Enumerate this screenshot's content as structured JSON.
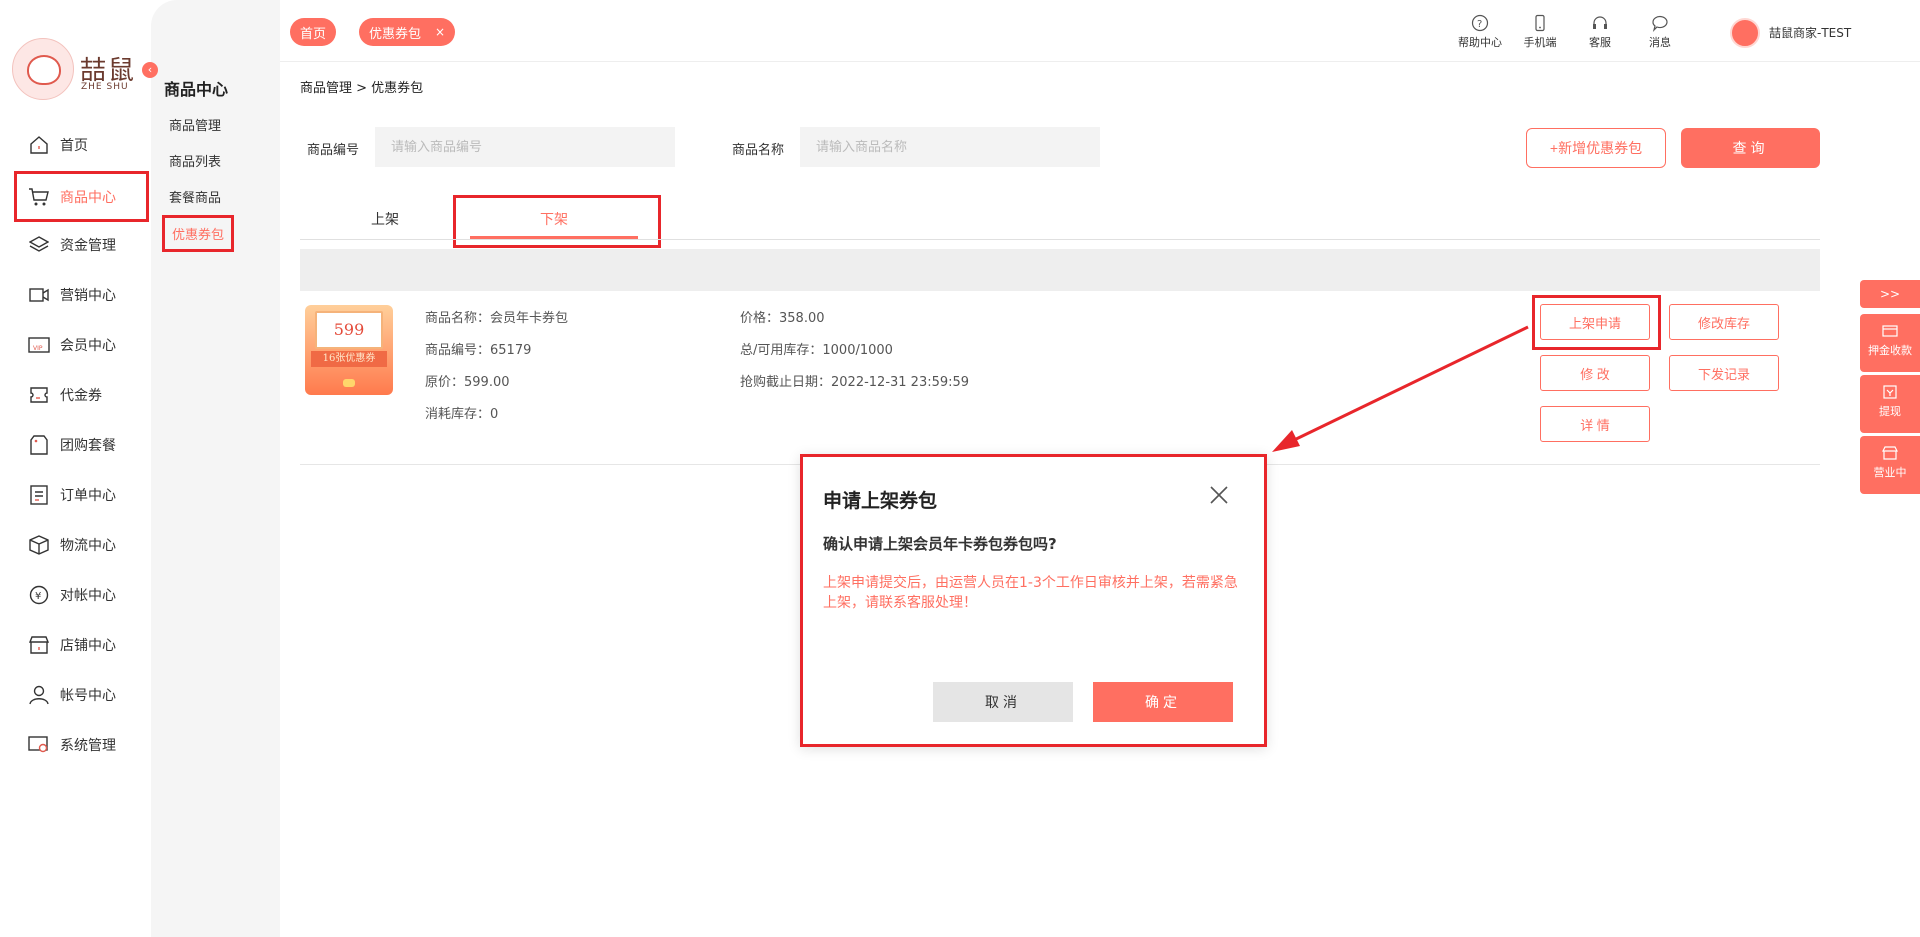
{
  "logo": {
    "text": "喆鼠",
    "subtext": "ZHE SHU"
  },
  "sidebar": {
    "collapse_icon": "chevron-left-icon",
    "items": [
      {
        "label": "首页",
        "icon": "home-icon"
      },
      {
        "label": "商品中心",
        "icon": "cart-icon"
      },
      {
        "label": "资金管理",
        "icon": "layers-icon"
      },
      {
        "label": "营销中心",
        "icon": "megaphone-icon"
      },
      {
        "label": "会员中心",
        "icon": "vip-card-icon"
      },
      {
        "label": "代金券",
        "icon": "voucher-icon"
      },
      {
        "label": "团购套餐",
        "icon": "tag-icon"
      },
      {
        "label": "订单中心",
        "icon": "order-list-icon"
      },
      {
        "label": "物流中心",
        "icon": "box-icon"
      },
      {
        "label": "对帐中心",
        "icon": "yuan-icon"
      },
      {
        "label": "店铺中心",
        "icon": "store-icon"
      },
      {
        "label": "帐号中心",
        "icon": "user-icon"
      },
      {
        "label": "系统管理",
        "icon": "settings-screen-icon"
      }
    ]
  },
  "submenu": {
    "title": "商品中心",
    "items": [
      {
        "label": "商品管理"
      },
      {
        "label": "商品列表"
      },
      {
        "label": "套餐商品"
      },
      {
        "label": "优惠券包"
      }
    ]
  },
  "topbar": {
    "tabs": [
      {
        "label": "首页"
      },
      {
        "label": "优惠券包",
        "close": "×"
      }
    ],
    "actions": [
      {
        "label": "帮助中心",
        "icon": "help-icon"
      },
      {
        "label": "手机端",
        "icon": "phone-icon"
      },
      {
        "label": "客服",
        "icon": "headset-icon"
      },
      {
        "label": "消息",
        "icon": "message-icon"
      }
    ],
    "user_name": "喆鼠商家-TEST"
  },
  "breadcrumb": "商品管理 > 优惠券包",
  "filters": {
    "code_label": "商品编号",
    "code_placeholder": "请输入商品编号",
    "name_label": "商品名称",
    "name_placeholder": "请输入商品名称",
    "add_button": "+新增优惠券包",
    "query_button": "查询"
  },
  "tabs": {
    "on_shelf": "上架",
    "off_shelf": "下架"
  },
  "product": {
    "thumb_price": "599",
    "thumb_caption": "16张优惠券",
    "name": "商品名称：会员年卡券包",
    "code": "商品编号：65179",
    "original_price": "原价：599.00",
    "consumed_stock": "消耗库存：0",
    "price": "价格：358.00",
    "stock": "总/可用库存：1000/1000",
    "deadline": "抢购截止日期：2022-12-31 23:59:59",
    "actions": {
      "apply": "上架申请",
      "edit_stock": "修改库存",
      "edit": "修 改",
      "dispatch_log": "下发记录",
      "detail": "详 情"
    }
  },
  "float_panel": {
    "expand": ">>",
    "items": [
      {
        "label": "押金收款",
        "icon": "card-icon"
      },
      {
        "label": "提现",
        "icon": "withdraw-icon"
      },
      {
        "label": "营业中",
        "icon": "shop-open-icon"
      }
    ]
  },
  "dialog": {
    "title": "申请上架券包",
    "question": "确认申请上架会员年卡券包券包吗?",
    "note": "上架申请提交后，由运营人员在1-3个工作日审核并上架，若需紧急上架，请联系客服处理！",
    "cancel": "取消",
    "confirm": "确定"
  },
  "colors": {
    "accent": "#ff6f61",
    "highlight_box": "#e8262b"
  }
}
